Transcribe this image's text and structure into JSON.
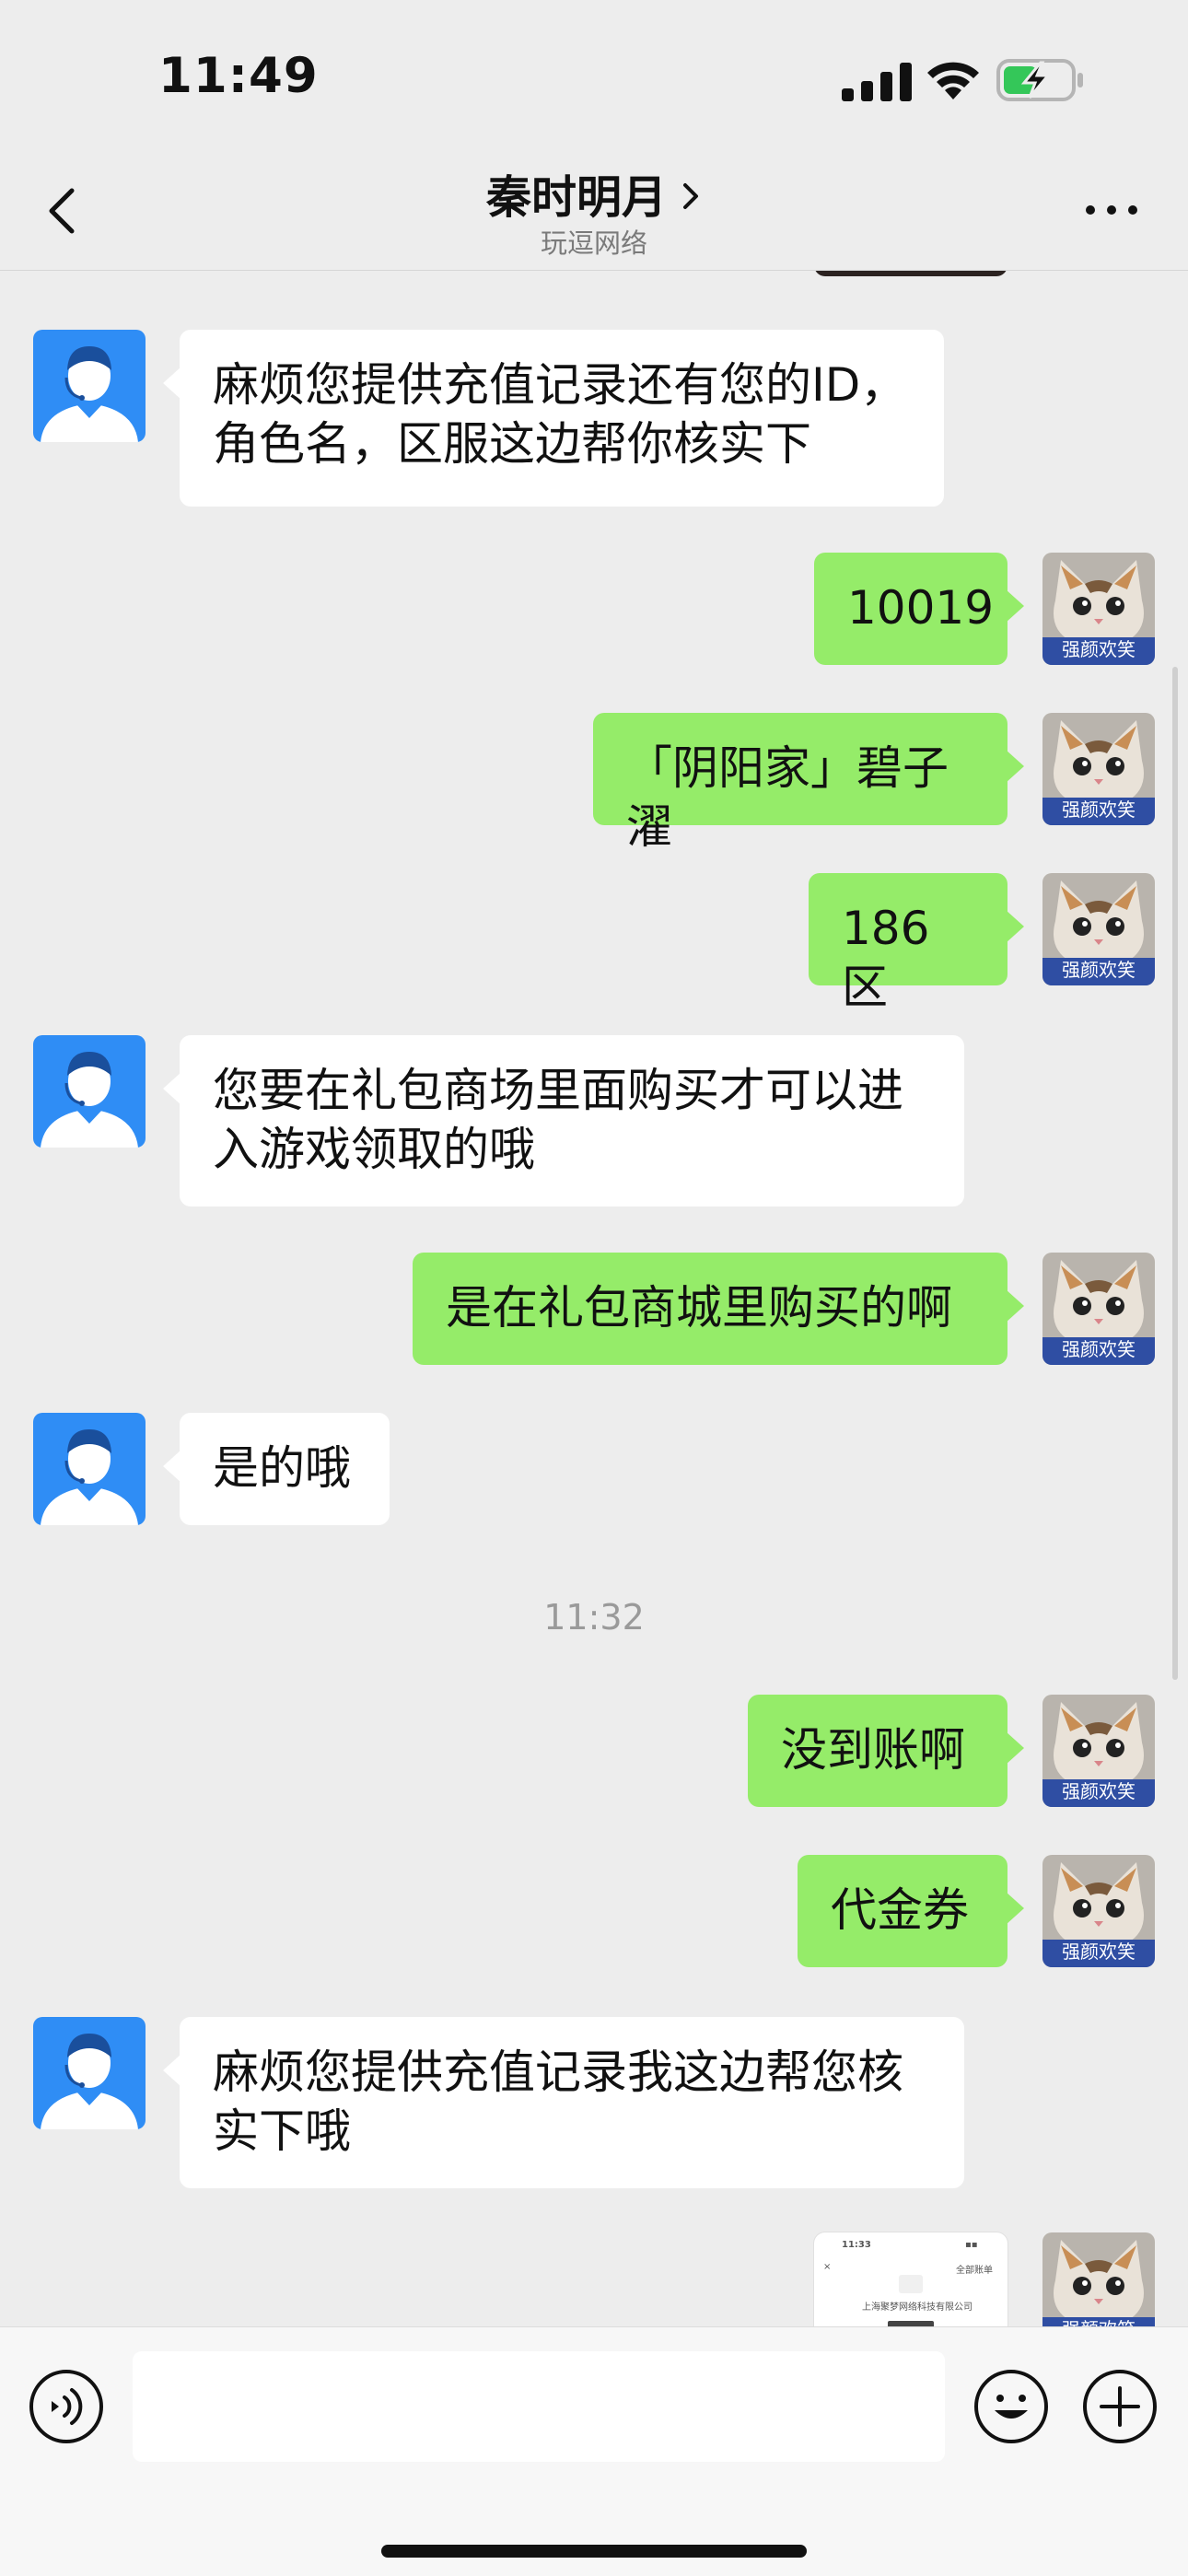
{
  "status_bar": {
    "time": "11:49"
  },
  "header": {
    "title": "秦时明月",
    "subtitle": "玩逗网络"
  },
  "messages": [
    {
      "text": "麻烦您提供充值记录还有您的ID，\n角色名，区服这边帮你核实下"
    },
    {
      "text": "10019"
    },
    {
      "text": "「阴阳家」碧子濯"
    },
    {
      "text": "186 区"
    },
    {
      "text": "您要在礼包商场里面购买才可以进\n入游戏领取的哦"
    },
    {
      "text": "是在礼包商城里购买的啊"
    },
    {
      "text": "是的哦"
    },
    {
      "text": "没到账啊"
    },
    {
      "text": "代金券"
    },
    {
      "text": "麻烦您提供充值记录我这边帮您核\n实下哦"
    }
  ],
  "timestamp": "11:32",
  "user_avatar_caption": "强颜欢笑",
  "screenshot_thumb": {
    "time": "11:33",
    "top_right": "全部账单",
    "company": "上海聚梦网络科技有限公司"
  },
  "input": {
    "placeholder": ""
  },
  "colors": {
    "background": "#ededed",
    "sent_bubble": "#95ec69",
    "received_bubble": "#ffffff",
    "agent_avatar": "#2f8df5"
  },
  "icons": [
    "back-arrow-icon",
    "chevron-right-icon",
    "more-dots-icon",
    "voice-icon",
    "emoji-icon",
    "plus-icon",
    "signal-icon",
    "wifi-icon",
    "battery-charging-icon"
  ]
}
